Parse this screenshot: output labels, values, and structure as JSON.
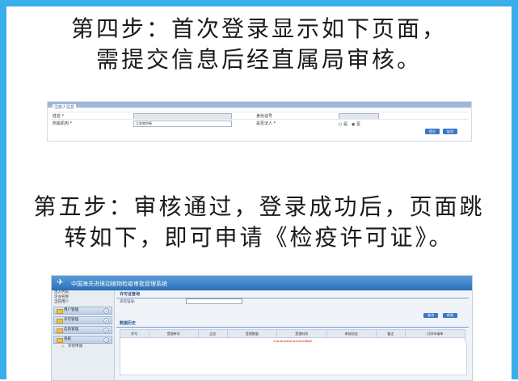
{
  "steps": {
    "step4_line1": "第四步：首次登录显示如下页面，",
    "step4_line2": "需提交信息后经直属局审核。",
    "step5_line1": "第五步：审核通过，登录成功后，页面跳",
    "step5_line2": "转如下，即可申请《检疫许可证》。"
  },
  "form1": {
    "legend": "注册人信息",
    "name_label": "姓名 *",
    "id_label": "身份证号",
    "org_label": "所属机构 *",
    "org_value": "江苏南京新",
    "legal_label": "是否法人 *",
    "radio_yes": "是",
    "radio_no": "否",
    "btn_submit": "提交",
    "btn_cancel": "取消"
  },
  "app": {
    "title": "中国海关进境动植物检疫审批管理系统",
    "user_lines": [
      "注入代码",
      "企业名称",
      "当前用户"
    ],
    "menus": [
      {
        "label": "用户管理"
      },
      {
        "label": "许可管理"
      },
      {
        "label": "信息管理"
      },
      {
        "label": "系统"
      }
    ],
    "submenu": "许可申请",
    "query_head": "许可证查询",
    "query_label": "许可证号:",
    "btn_query": "查询",
    "btn_add": "新增",
    "list_head": "数据历史",
    "columns": [
      "序号",
      "受理单号",
      "品名",
      "受理数量",
      "受理时间",
      "审核状态",
      "备注",
      "打印申请单"
    ],
    "empty_msg": "没有查询到符合条件的数据"
  },
  "colors": {
    "frame": "#39aee8",
    "banner": "#2a6fb8",
    "button": "#3c78c8"
  }
}
